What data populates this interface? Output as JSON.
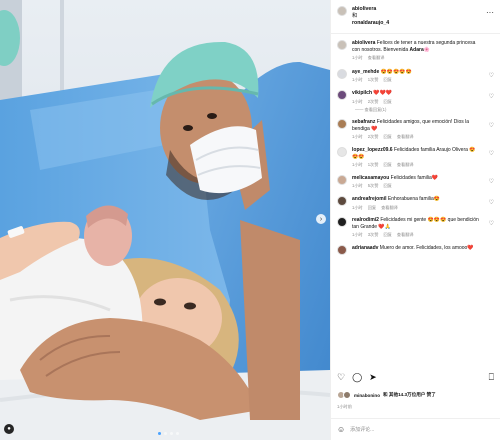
{
  "header": {
    "author": "abiolivera",
    "connector": "和",
    "collaborator": "ronaldaraujo_4",
    "more_label": "···"
  },
  "caption": {
    "user": "abiolivera",
    "text": "Felices de tener a nuestra segunda princesa con nosotros. Bienvenida",
    "name": "Adara",
    "time": "1小时",
    "translate": "查看翻译"
  },
  "comments": [
    {
      "user": "aye_mehde",
      "text": "😍😍😍😍😍",
      "time": "1小时",
      "likes": "1次赞",
      "reply": "回复"
    },
    {
      "user": "vikipilch",
      "text": "❤️❤️❤️",
      "time": "1小时",
      "likes": "2次赞",
      "reply": "回复",
      "replies": "—— 查看回复(1)"
    },
    {
      "user": "sebafranz",
      "text": "Felicidades amigos, que emoción! Dios la bendiga ❤️",
      "time": "1小时",
      "likes": "2次赞",
      "reply": "回复",
      "translate": "查看翻译"
    },
    {
      "user": "lopez_lopezz09.6",
      "text": "Felicidades familia Araujo Olivera 😍😍😍",
      "time": "1小时",
      "likes": "1次赞",
      "reply": "回复",
      "translate": "查看翻译"
    },
    {
      "user": "melicasamayou",
      "text": "Felicidades familia❤️",
      "time": "1小时",
      "likes": "5次赞",
      "reply": "回复"
    },
    {
      "user": "andreafrejomil",
      "text": "Enhorabuena familia😍",
      "time": "1小时",
      "likes": "",
      "reply": "回复",
      "translate": "查看翻译"
    },
    {
      "user": "realrodimi2",
      "text": "Felicidades mi gente 😍😍😍 que bendición tan Grande ❤️🙏",
      "time": "1小时",
      "likes": "3次赞",
      "reply": "回复",
      "translate": "查看翻译"
    },
    {
      "user": "adrianaadv",
      "text": "Muero de amor. Felicidades, los amooo❤️",
      "time": "",
      "likes": "",
      "reply": ""
    }
  ],
  "actions": {
    "like_icon": "heart-icon",
    "comment_icon": "comment-icon",
    "share_icon": "share-icon",
    "save_icon": "bookmark-icon"
  },
  "likes_text": {
    "user": "minabonino",
    "rest": "和 其他14.3万位用户 赞了"
  },
  "post_time": "1小时前",
  "add_comment": {
    "emoji": "☺",
    "placeholder": "添加评论..."
  },
  "colors": {
    "accent": "#0095f6",
    "scrubs": "#5b9fdc",
    "cap": "#7fd1c6"
  }
}
